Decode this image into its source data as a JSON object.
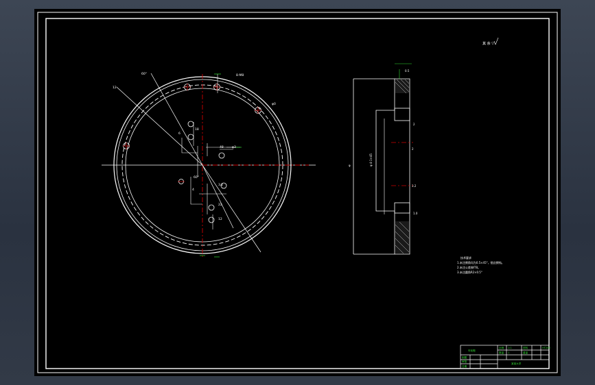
{
  "colors": {
    "background": "#000000",
    "frame": "#ffffff",
    "centerline": "#d00000",
    "dimension": "#33dd33",
    "text": "#ffffff"
  },
  "front_view_labels": [
    "60°",
    "8-M8",
    "φ0",
    "12",
    "18",
    "6",
    "48",
    "φ3",
    "60°",
    "3.2",
    "4",
    "22",
    "12"
  ],
  "side_view_labels": [
    "0.5",
    "φ",
    "2",
    "φ 4-1×45",
    "2",
    "3.2",
    "1.0"
  ],
  "roughness_note": "其 余 ▽",
  "tech_requirements": {
    "title": "技术要求",
    "items": [
      "1.未注倒角均为0.5×45°，锐边倒钝。",
      "2.未注公差按IT8。",
      "3.未注圆角R2×0.5°"
    ]
  },
  "title_block": {
    "part_name": "车轮毂",
    "cells": [
      "比例",
      "1:1",
      "材料",
      "HT200",
      "数量",
      "1",
      "重量",
      "",
      "制图",
      "",
      "审核",
      "",
      "日期",
      ""
    ],
    "school": "某某大学"
  },
  "icons": [
    "roughness-symbol-icon"
  ]
}
